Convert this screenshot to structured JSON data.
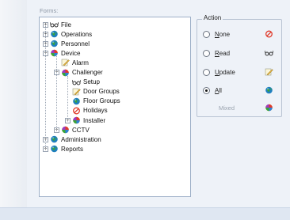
{
  "forms_label": "Forms:",
  "tree": [
    {
      "label": "File",
      "icon": "glasses-icon",
      "expander": "+"
    },
    {
      "label": "Operations",
      "icon": "globe-icon",
      "expander": "+"
    },
    {
      "label": "Personnel",
      "icon": "globe-icon",
      "expander": "+"
    },
    {
      "label": "Device",
      "icon": "multicolor-ball-icon",
      "expander": "−"
    },
    {
      "label": "Alarm",
      "icon": "pencil-note-icon",
      "expander": ""
    },
    {
      "label": "Challenger",
      "icon": "multicolor-ball-icon",
      "expander": "−"
    },
    {
      "label": "Setup",
      "icon": "glasses-icon",
      "expander": ""
    },
    {
      "label": "Door Groups",
      "icon": "pencil-note-icon",
      "expander": ""
    },
    {
      "label": "Floor Groups",
      "icon": "globe-icon",
      "expander": ""
    },
    {
      "label": "Holidays",
      "icon": "no-entry-icon",
      "expander": ""
    },
    {
      "label": "Installer",
      "icon": "multicolor-ball-icon",
      "expander": "+"
    },
    {
      "label": "CCTV",
      "icon": "multicolor-ball-icon",
      "expander": "+"
    },
    {
      "label": "Administration",
      "icon": "globe-icon",
      "expander": "+"
    },
    {
      "label": "Reports",
      "icon": "globe-icon",
      "expander": "+"
    }
  ],
  "action": {
    "title": "Action",
    "options": [
      {
        "label": "None",
        "underline": "N",
        "rest": "one",
        "icon": "no-entry-icon",
        "checked": false
      },
      {
        "label": "Read",
        "underline": "R",
        "rest": "ead",
        "icon": "glasses-icon",
        "checked": false
      },
      {
        "label": "Update",
        "underline": "U",
        "rest": "pdate",
        "icon": "pencil-note-icon",
        "checked": false
      },
      {
        "label": "All",
        "underline": "A",
        "rest": "ll",
        "icon": "globe-icon",
        "checked": true
      }
    ],
    "mixed_label": "Mixed",
    "mixed_icon": "multicolor-ball-icon"
  },
  "colors": {
    "panel": "#eef2f8",
    "tree_border": "#9eb0c8",
    "no_entry": "#e03a2a",
    "globe": "#1f7fbf"
  }
}
